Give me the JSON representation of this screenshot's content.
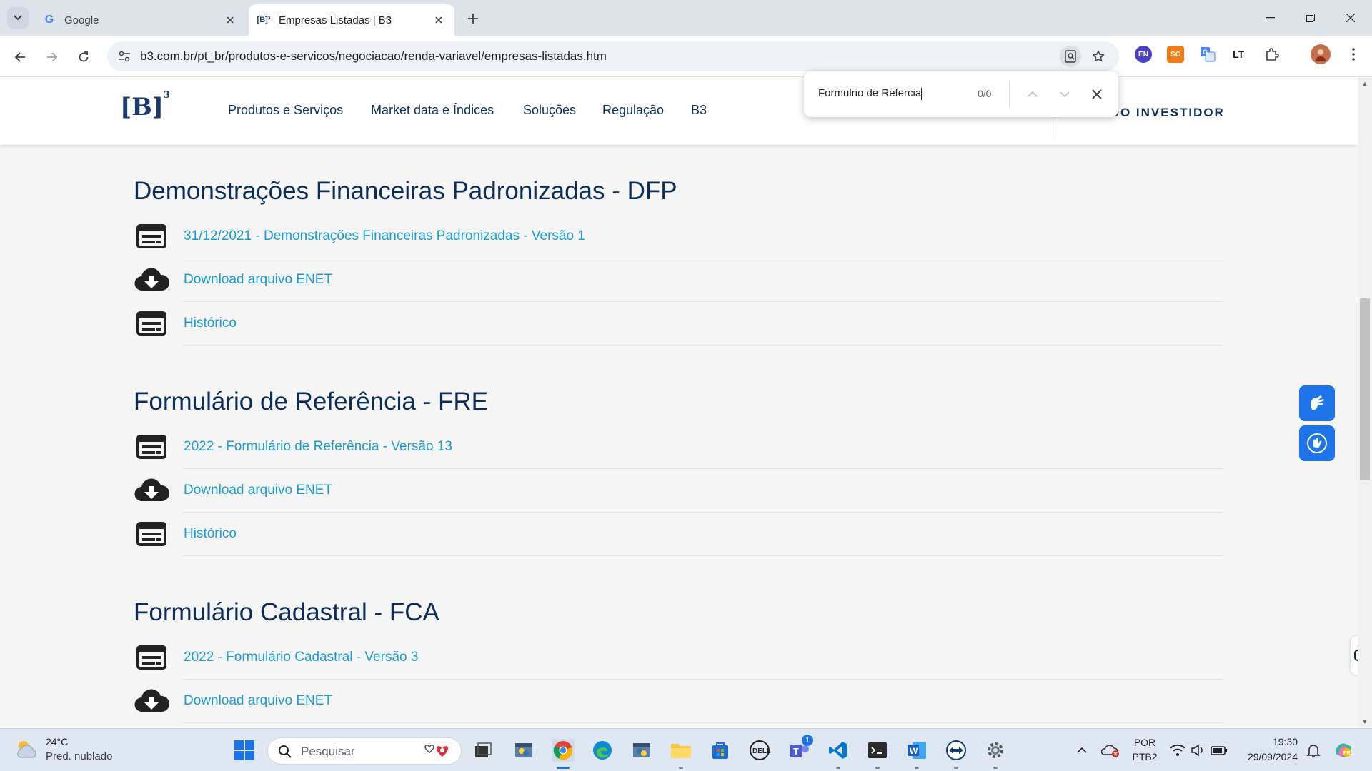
{
  "browser": {
    "tabs": [
      {
        "title": "Google",
        "favicon": "G"
      },
      {
        "title": "Empresas Listadas | B3",
        "favicon": "[B]³"
      }
    ],
    "url": "b3.com.br/pt_br/produtos-e-servicos/negociacao/renda-variavel/empresas-listadas.htm",
    "extensions": [
      "EN",
      "SC"
    ]
  },
  "find_bar": {
    "query": "Formulrio de Refercia",
    "count": "0/0"
  },
  "site": {
    "logo": "[B]",
    "logo_sup": "3",
    "nav": [
      "Produtos e Serviços",
      "Market data e Índices",
      "Soluções",
      "Regulação",
      "B3"
    ],
    "investor_area": "ÁREA DO INVESTIDOR",
    "investor_visible": "EA DO INVESTIDOR"
  },
  "sections": [
    {
      "title": "Demonstrações Financeiras Padronizadas - DFP",
      "items": [
        {
          "icon": "document-icon",
          "label": "31/12/2021 - Demonstrações Financeiras Padronizadas - Versão 1"
        },
        {
          "icon": "cloud-download-icon",
          "label": "Download arquivo ENET"
        },
        {
          "icon": "document-icon",
          "label": "Histórico"
        }
      ]
    },
    {
      "title": "Formulário de Referência - FRE",
      "items": [
        {
          "icon": "document-icon",
          "label": "2022 - Formulário de Referência - Versão 13"
        },
        {
          "icon": "cloud-download-icon",
          "label": "Download arquivo ENET"
        },
        {
          "icon": "document-icon",
          "label": "Histórico"
        }
      ]
    },
    {
      "title": "Formulário Cadastral - FCA",
      "items": [
        {
          "icon": "document-icon",
          "label": "2022 - Formulário Cadastral - Versão 3"
        },
        {
          "icon": "cloud-download-icon",
          "label": "Download arquivo ENET"
        }
      ]
    }
  ],
  "taskbar": {
    "weather_temp": "24°C",
    "weather_desc": "Pred. nublado",
    "search_placeholder": "Pesquisar",
    "teams_badge": "1",
    "lang_top": "POR",
    "lang_bottom": "PTB2",
    "time": "19:30",
    "date": "29/09/2024"
  },
  "colors": {
    "link": "#1a9bd1",
    "heading": "#0b2d5a",
    "vlibras": "#1e73e8"
  }
}
